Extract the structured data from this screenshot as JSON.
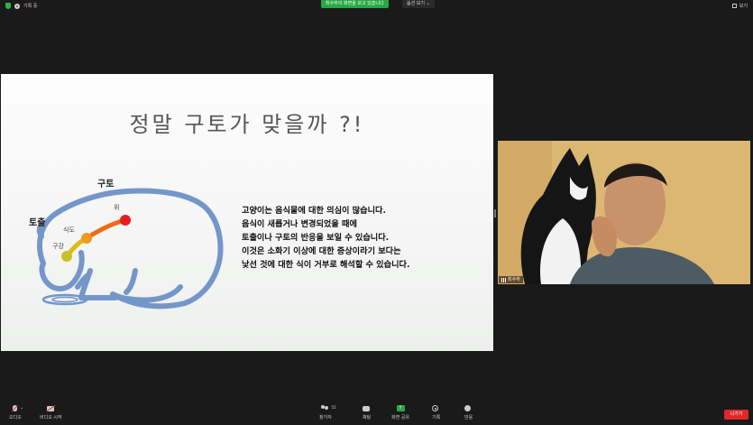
{
  "topbar": {
    "recording_label": "기록 중",
    "share_banner": "최수하의 화면을 보고 있습니다",
    "view_options": "옵션 보기",
    "view_button": "보기"
  },
  "slide": {
    "title": "정말 구토가 맞을까 ?!",
    "lines": [
      "고양이는  음식물에 대한 의심이 많습니다.",
      "음식이 새롭거나 변경되었을 때에",
      "토출이나 구토의 반응을 보일 수 있습니다.",
      "이것은 소화기 이상에 대한 증상이라기 보다는",
      "낯선 것에 대한 식이 거부로 해석할 수 있습니다."
    ],
    "diagram_labels": {
      "vomit": "구토",
      "regurgitation": "토출",
      "stomach": "위",
      "esophagus": "식도",
      "mouth": "구강"
    },
    "colors": {
      "cat_outline": "#7596c9",
      "mouth_dot": "#c9c12a",
      "esophagus_dot": "#ee9a1e",
      "stomach_dot": "#e61e1e"
    }
  },
  "video": {
    "participant_name": "최수하"
  },
  "toolbar": {
    "mute": "오디오",
    "video": "비디오 시작",
    "participants": "참가자",
    "participants_count": "55",
    "chat": "채팅",
    "share": "화면 공유",
    "record": "기록",
    "reactions": "반응",
    "leave": "나가기"
  }
}
